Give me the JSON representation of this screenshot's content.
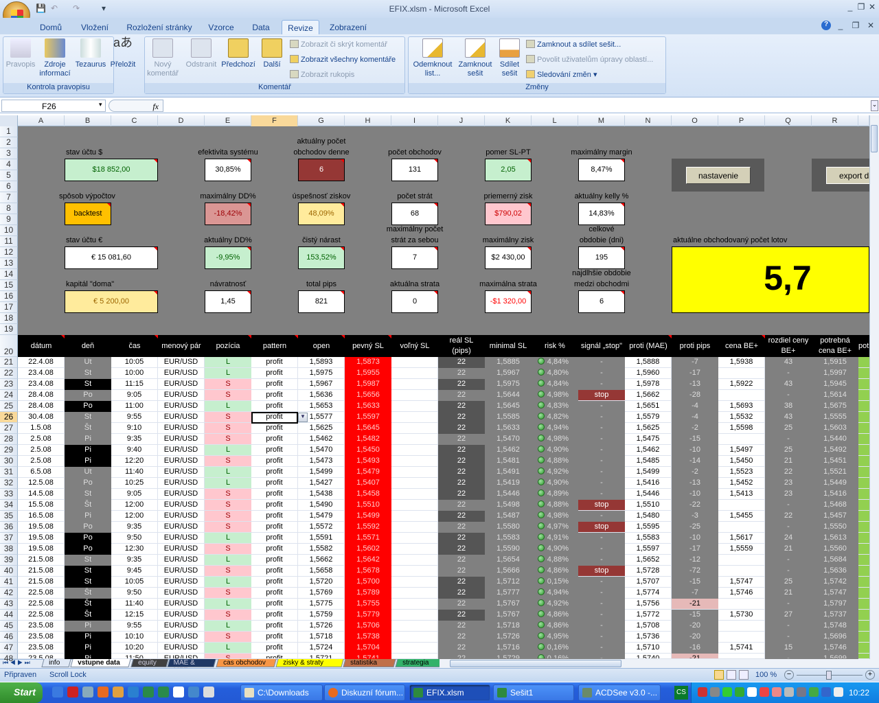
{
  "window": {
    "title": "EFIX.xlsm - Microsoft Excel"
  },
  "ribbon": {
    "tabs": [
      "Domů",
      "Vložení",
      "Rozložení stránky",
      "Vzorce",
      "Data",
      "Revize",
      "Zobrazení"
    ],
    "active_tab": "Revize",
    "groups": {
      "proofing": {
        "label": "Kontrola pravopisu",
        "buttons": [
          "Pravopis",
          "Zdroje informací",
          "Tezaurus",
          "Přeložit"
        ]
      },
      "comments": {
        "label": "Komentář",
        "buttons": [
          "Nový komentář",
          "Odstranit",
          "Předchozí",
          "Další"
        ],
        "small": [
          "Zobrazit či skrýt komentář",
          "Zobrazit všechny komentáře",
          "Zobrazit rukopis"
        ]
      },
      "changes": {
        "label": "Změny",
        "buttons": [
          "Odemknout list...",
          "Zamknout sešit",
          "Sdílet sešit"
        ],
        "small": [
          "Zamknout a sdílet sešit...",
          "Povolit uživatelům úpravy oblastí...",
          "Sledování změn"
        ]
      }
    }
  },
  "formula_bar": {
    "name_box": "F26",
    "fx": "fx",
    "formula": ""
  },
  "columns": [
    "A",
    "B",
    "C",
    "D",
    "E",
    "F",
    "G",
    "H",
    "I",
    "J",
    "K",
    "L",
    "M",
    "N",
    "O",
    "P",
    "Q",
    "R"
  ],
  "selected_column": "F",
  "selected_row": 26,
  "dashboard": {
    "stav_usd": {
      "label": "stav účtu $",
      "value": "$18 852,00"
    },
    "efektivita": {
      "label": "efektivita systému",
      "value": "30,85%"
    },
    "obchody_denne": {
      "label1": "aktuálny počet",
      "label2": "obchodov denne",
      "value": "6"
    },
    "pocet_obchodov": {
      "label": "počet obchodov",
      "value": "131"
    },
    "pomer": {
      "label": "pomer SL-PT",
      "value": "2,05"
    },
    "max_margin": {
      "label": "maximálny margin",
      "value": "8,47%"
    },
    "sposob": {
      "label": "spôsob výpočtov",
      "value": "backtest"
    },
    "max_dd": {
      "label": "maximálny DD%",
      "value": "-18,42%"
    },
    "uspesnost": {
      "label": "úspešnosť ziskov",
      "value": "48,09%"
    },
    "pocet_strat": {
      "label": "počet strát",
      "value": "68"
    },
    "priemerny_zisk": {
      "label": "priemerný zisk",
      "value": "$790,02"
    },
    "kelly": {
      "label": "aktuálny kelly %",
      "value": "14,83%"
    },
    "stav_eur": {
      "label": "stav účtu €",
      "value": "€ 15 081,60"
    },
    "akt_dd": {
      "label": "aktuálny DD%",
      "value": "-9,95%"
    },
    "cisty_narast": {
      "label": "čistý nárast",
      "value": "153,52%"
    },
    "max_strat_seria": {
      "label1": "maximálny počet",
      "label2": "strát za sebou",
      "value": "7"
    },
    "max_zisk": {
      "label": "maximálny zisk",
      "value": "$2 430,00"
    },
    "obdobie": {
      "label1": "celkové",
      "label2": "obdobie (dni)",
      "value": "195"
    },
    "kapital": {
      "label": "kapitál \"doma\"",
      "value": "€ 5 200,00"
    },
    "navratnost": {
      "label": "návratnosť",
      "value": "1,45"
    },
    "total_pips": {
      "label": "total pips",
      "value": "821"
    },
    "akt_strata": {
      "label": "aktuálna strata",
      "value": "0"
    },
    "max_strata": {
      "label": "maximálna strata",
      "value": "-$1 320,00"
    },
    "najdlhsie": {
      "label1": "najdlhšie obdobie",
      "label2": "medzi obchodmi",
      "value": "6"
    },
    "loty": {
      "label": "aktuálne obchodovaný počet lotov",
      "value": "5,7"
    },
    "nastavenie_btn": "nastavenie",
    "export_btn": "export da"
  },
  "table": {
    "headers": [
      "dátum",
      "deň",
      "čas",
      "menový pár",
      "pozícia",
      "pattern",
      "open",
      "pevný SL",
      "voľný SL",
      "reál SL\n(pips)",
      "minimal SL",
      "risk %",
      "signál „stop\"",
      "proti (MAE)",
      "proti pips",
      "cena BE+",
      "rozdiel ceny\nBE+",
      "potrebná\ncena BE+",
      "pot"
    ],
    "pair": "EUR/USD",
    "pattern": "profit",
    "real_sl": "22",
    "rows": [
      [
        21,
        "22.4.08",
        "Ut",
        0,
        "10:05",
        "L",
        "1,5893",
        "1,5873",
        1,
        "1,5885",
        "4,84%",
        "-",
        "1,5888",
        "-7",
        0,
        "1,5938",
        "43",
        "1,5915"
      ],
      [
        22,
        "23.4.08",
        "St",
        0,
        "10:00",
        "L",
        "1,5975",
        "1,5955",
        0,
        "1,5967",
        "4,80%",
        "-",
        "1,5960",
        "-17",
        0,
        "",
        "-",
        "1,5997"
      ],
      [
        23,
        "23.4.08",
        "St",
        1,
        "11:15",
        "S",
        "1,5967",
        "1,5987",
        1,
        "1,5975",
        "4,84%",
        "-",
        "1,5978",
        "-13",
        0,
        "1,5922",
        "43",
        "1,5945"
      ],
      [
        24,
        "28.4.08",
        "Po",
        0,
        "9:05",
        "S",
        "1,5636",
        "1,5656",
        0,
        "1,5644",
        "4,98%",
        "stop",
        "1,5662",
        "-28",
        0,
        "",
        "-",
        "1,5614"
      ],
      [
        25,
        "28.4.08",
        "Po",
        1,
        "11:00",
        "L",
        "1,5653",
        "1,5633",
        1,
        "1,5645",
        "4,83%",
        "-",
        "1,5651",
        "-4",
        0,
        "1,5693",
        "38",
        "1,5675"
      ],
      [
        26,
        "30.4.08",
        "St",
        0,
        "9:55",
        "S",
        "1,5577",
        "1,5597",
        1,
        "1,5585",
        "4,82%",
        "-",
        "1,5579",
        "-4",
        0,
        "1,5532",
        "43",
        "1,5555"
      ],
      [
        27,
        "1.5.08",
        "Št",
        0,
        "9:10",
        "S",
        "1,5625",
        "1,5645",
        1,
        "1,5633",
        "4,94%",
        "-",
        "1,5625",
        "-2",
        0,
        "1,5598",
        "25",
        "1,5603"
      ],
      [
        28,
        "2.5.08",
        "Pi",
        0,
        "9:35",
        "S",
        "1,5462",
        "1,5482",
        0,
        "1,5470",
        "4,98%",
        "-",
        "1,5475",
        "-15",
        0,
        "",
        "-",
        "1,5440"
      ],
      [
        29,
        "2.5.08",
        "Pi",
        1,
        "9:40",
        "L",
        "1,5470",
        "1,5450",
        1,
        "1,5462",
        "4,90%",
        "-",
        "1,5462",
        "-10",
        0,
        "1,5497",
        "25",
        "1,5492"
      ],
      [
        30,
        "2.5.08",
        "Pi",
        1,
        "12:20",
        "S",
        "1,5473",
        "1,5493",
        1,
        "1,5481",
        "4,88%",
        "-",
        "1,5485",
        "-14",
        0,
        "1,5450",
        "21",
        "1,5451"
      ],
      [
        31,
        "6.5.08",
        "Ut",
        0,
        "11:40",
        "L",
        "1,5499",
        "1,5479",
        1,
        "1,5491",
        "4,92%",
        "-",
        "1,5499",
        "-2",
        0,
        "1,5523",
        "22",
        "1,5521"
      ],
      [
        32,
        "12.5.08",
        "Po",
        0,
        "10:25",
        "L",
        "1,5427",
        "1,5407",
        1,
        "1,5419",
        "4,90%",
        "-",
        "1,5416",
        "-13",
        0,
        "1,5452",
        "23",
        "1,5449"
      ],
      [
        33,
        "14.5.08",
        "St",
        0,
        "9:05",
        "S",
        "1,5438",
        "1,5458",
        1,
        "1,5446",
        "4,89%",
        "-",
        "1,5446",
        "-10",
        0,
        "1,5413",
        "23",
        "1,5416"
      ],
      [
        34,
        "15.5.08",
        "Št",
        0,
        "12:00",
        "S",
        "1,5490",
        "1,5510",
        0,
        "1,5498",
        "4,88%",
        "stop",
        "1,5510",
        "-22",
        0,
        "",
        "-",
        "1,5468"
      ],
      [
        35,
        "16.5.08",
        "Pi",
        0,
        "12:00",
        "S",
        "1,5479",
        "1,5499",
        1,
        "1,5487",
        "4,98%",
        "-",
        "1,5480",
        "-3",
        0,
        "1,5455",
        "22",
        "1,5457"
      ],
      [
        36,
        "19.5.08",
        "Po",
        0,
        "9:35",
        "S",
        "1,5572",
        "1,5592",
        0,
        "1,5580",
        "4,97%",
        "stop",
        "1,5595",
        "-25",
        0,
        "",
        "-",
        "1,5550"
      ],
      [
        37,
        "19.5.08",
        "Po",
        1,
        "9:50",
        "L",
        "1,5591",
        "1,5571",
        1,
        "1,5583",
        "4,91%",
        "-",
        "1,5583",
        "-10",
        0,
        "1,5617",
        "24",
        "1,5613"
      ],
      [
        38,
        "19.5.08",
        "Po",
        1,
        "12:30",
        "S",
        "1,5582",
        "1,5602",
        1,
        "1,5590",
        "4,90%",
        "-",
        "1,5597",
        "-17",
        0,
        "1,5559",
        "21",
        "1,5560"
      ],
      [
        39,
        "21.5.08",
        "St",
        0,
        "9:35",
        "L",
        "1,5662",
        "1,5642",
        0,
        "1,5654",
        "4,88%",
        "-",
        "1,5652",
        "-12",
        0,
        "",
        "-",
        "1,5684"
      ],
      [
        40,
        "21.5.08",
        "St",
        1,
        "9:45",
        "S",
        "1,5658",
        "1,5678",
        0,
        "1,5666",
        "4,86%",
        "stop",
        "1,5728",
        "-72",
        0,
        "",
        "-",
        "1,5636"
      ],
      [
        41,
        "21.5.08",
        "St",
        1,
        "10:05",
        "L",
        "1,5720",
        "1,5700",
        1,
        "1,5712",
        "0,15%",
        "-",
        "1,5707",
        "-15",
        0,
        "1,5747",
        "25",
        "1,5742"
      ],
      [
        42,
        "22.5.08",
        "Št",
        0,
        "9:50",
        "S",
        "1,5769",
        "1,5789",
        1,
        "1,5777",
        "4,94%",
        "-",
        "1,5774",
        "-7",
        0,
        "1,5746",
        "21",
        "1,5747"
      ],
      [
        43,
        "22.5.08",
        "Št",
        1,
        "11:40",
        "L",
        "1,5775",
        "1,5755",
        0,
        "1,5767",
        "4,92%",
        "-",
        "1,5756",
        "-21",
        1,
        "",
        "-",
        "1,5797"
      ],
      [
        44,
        "22.5.08",
        "Št",
        1,
        "12:15",
        "S",
        "1,5759",
        "1,5779",
        1,
        "1,5767",
        "4,86%",
        "-",
        "1,5772",
        "-15",
        0,
        "1,5730",
        "27",
        "1,5737"
      ],
      [
        45,
        "23.5.08",
        "Pi",
        0,
        "9:55",
        "L",
        "1,5726",
        "1,5706",
        0,
        "1,5718",
        "4,86%",
        "-",
        "1,5708",
        "-20",
        0,
        "",
        "-",
        "1,5748"
      ],
      [
        46,
        "23.5.08",
        "Pi",
        1,
        "10:10",
        "S",
        "1,5718",
        "1,5738",
        0,
        "1,5726",
        "4,95%",
        "-",
        "1,5736",
        "-20",
        0,
        "",
        "-",
        "1,5696"
      ],
      [
        47,
        "23.5.08",
        "Pi",
        1,
        "10:20",
        "L",
        "1,5724",
        "1,5704",
        0,
        "1,5716",
        "0,16%",
        "-",
        "1,5710",
        "-16",
        0,
        "1,5741",
        "15",
        "1,5746"
      ],
      [
        48,
        "23.5.08",
        "Pi",
        1,
        "11:50",
        "S",
        "1,5721",
        "1,5741",
        0,
        "1,5729",
        "0,16%",
        "-",
        "1,5740",
        "-21",
        1,
        "",
        "-",
        "1,5699"
      ]
    ]
  },
  "sheet_tabs": [
    {
      "label": "info",
      "color": "#dfe8f5"
    },
    {
      "label": "vstupne data",
      "color": "#ffffff"
    },
    {
      "label": "equity",
      "color": "#404040"
    },
    {
      "label": "MAE & MFE",
      "color": "#1f3864"
    },
    {
      "label": "cas obchodov",
      "color": "#f79646"
    },
    {
      "label": "zisky & straty",
      "color": "#ffff00"
    },
    {
      "label": "statistika",
      "color": "#c0704a"
    },
    {
      "label": "strategia",
      "color": "#33b26a"
    }
  ],
  "active_sheet": "vstupne data",
  "status": {
    "ready": "Připraven",
    "scroll_lock": "Scroll Lock",
    "zoom": "100 %"
  },
  "taskbar": {
    "start": "Start",
    "items": [
      "C:\\Downloads",
      "Diskuzní fórum...",
      "EFIX.xlsm",
      "Sešit1",
      "ACDSee v3.0 -..."
    ],
    "active": "EFIX.xlsm",
    "lang": "CS",
    "clock": "10:22"
  }
}
